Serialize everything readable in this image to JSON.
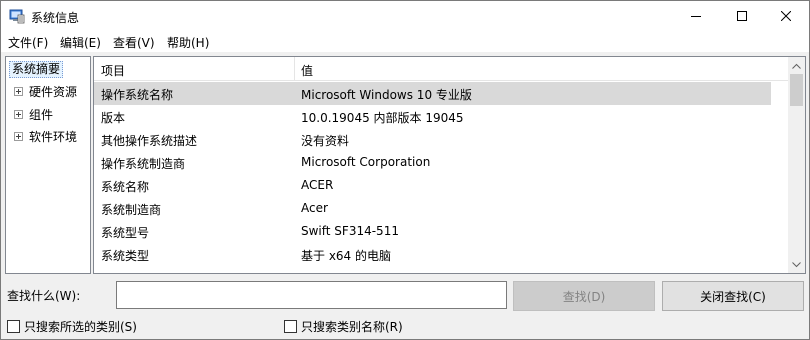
{
  "window": {
    "title": "系统信息"
  },
  "title_controls": {
    "minimize_icon": "minimize-icon",
    "maximize_icon": "maximize-icon",
    "close_icon": "close-icon"
  },
  "menu": [
    {
      "label": "文件(F)"
    },
    {
      "label": "编辑(E)"
    },
    {
      "label": "查看(V)"
    },
    {
      "label": "帮助(H)"
    }
  ],
  "tree": {
    "root": "系统摘要",
    "children": [
      "硬件资源",
      "组件",
      "软件环境"
    ]
  },
  "list": {
    "columns": [
      "项目",
      "值"
    ],
    "rows": [
      {
        "item": "操作系统名称",
        "value": "Microsoft Windows 10 专业版",
        "selected": true
      },
      {
        "item": "版本",
        "value": "10.0.19045 内部版本 19045"
      },
      {
        "item": "其他操作系统描述",
        "value": "没有资料"
      },
      {
        "item": "操作系统制造商",
        "value": "Microsoft Corporation"
      },
      {
        "item": "系统名称",
        "value": "ACER"
      },
      {
        "item": "系统制造商",
        "value": "Acer"
      },
      {
        "item": "系统型号",
        "value": "Swift SF314-511"
      },
      {
        "item": "系统类型",
        "value": "基于 x64 的电脑"
      }
    ]
  },
  "find": {
    "label": "查找什么(W):",
    "value": "",
    "find_button": "查找(D)",
    "close_find_button": "关闭查找(C)",
    "search_selected_category": "只搜索所选的类别(S)",
    "search_category_names": "只搜索类别名称(R)"
  }
}
